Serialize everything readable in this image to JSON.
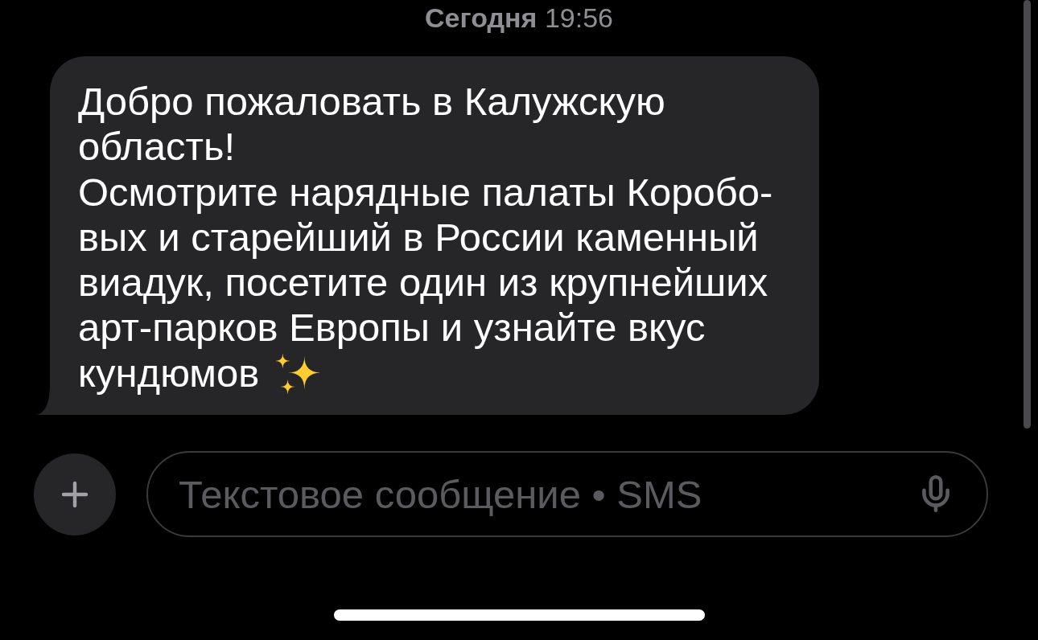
{
  "timestamp": "**Сегодня** 19:56",
  "messages": [
    {
      "kind": "incoming",
      "lines": [
        "Добро пожаловать в Калужскую",
        "область!",
        "Осмотрите нарядные палаты Коробо-",
        "вых и старейший в России каменный",
        "виадук, посетите один из крупнейших",
        "арт-парков Европы и узнайте вкус",
        "кундюмов"
      ]
    }
  ],
  "composer": {
    "placeholder": "Текстовое сообщение • SMS"
  }
}
